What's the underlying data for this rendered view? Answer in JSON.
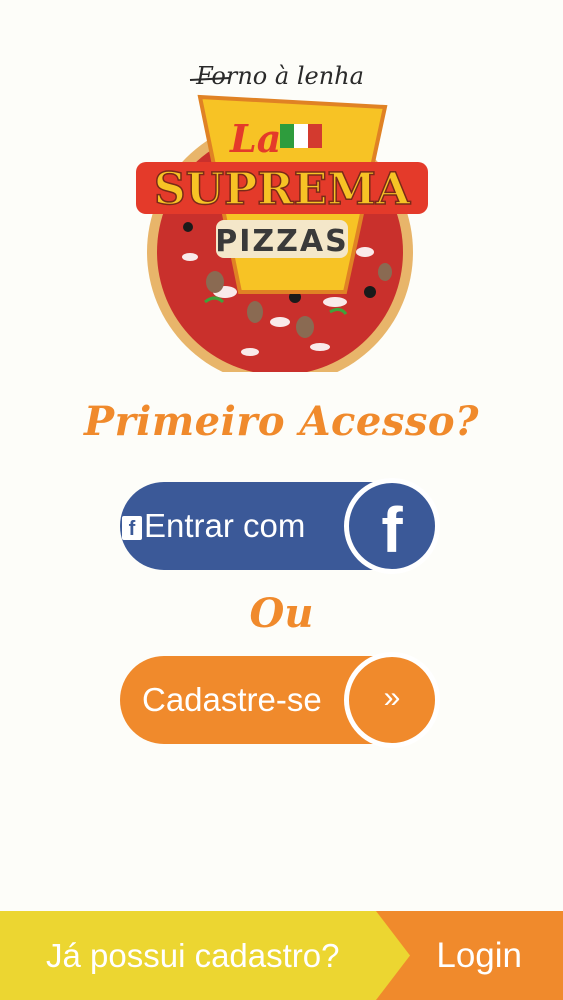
{
  "logo": {
    "tagline": "Forno à lenha",
    "la": "La",
    "brand": "SUPREMA",
    "subtitle": "PIZZAS"
  },
  "headline": "Primeiro Acesso?",
  "facebook_button": {
    "small_icon_glyph": "f",
    "label": "Entrar com",
    "icon": "facebook-icon",
    "icon_glyph": "f",
    "color": "#3b5998"
  },
  "separator": "Ou",
  "register_button": {
    "label": "Cadastre-se",
    "icon": "double-chevron-right-icon",
    "icon_glyph": "»",
    "color": "#f08a2c"
  },
  "footer": {
    "question": "Já possui cadastro?",
    "login_label": "Login",
    "left_color": "#ecd631",
    "right_color": "#f08a2c"
  },
  "colors": {
    "background": "#fdfdf9",
    "accent": "#f08a2c"
  }
}
